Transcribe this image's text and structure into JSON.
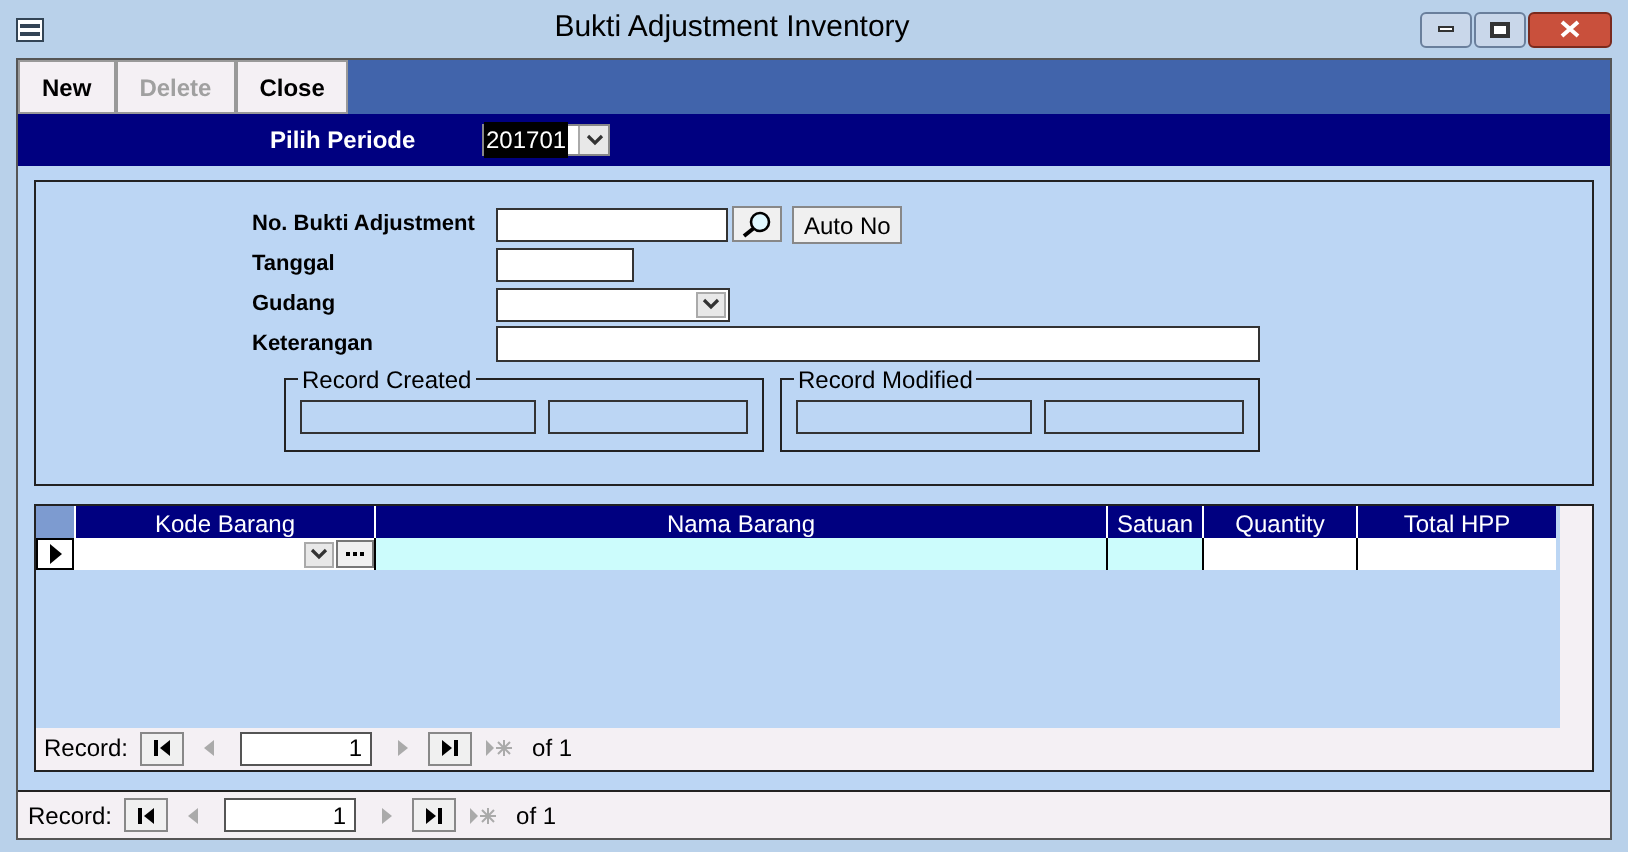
{
  "window": {
    "title": "Bukti Adjustment Inventory"
  },
  "toolbar": [
    {
      "label": "New",
      "disabled": false
    },
    {
      "label": "Delete",
      "disabled": true
    },
    {
      "label": "Close",
      "disabled": false
    }
  ],
  "period": {
    "label": "Pilih Periode",
    "value": "201701"
  },
  "fields": [
    {
      "kind": "search",
      "label": "No. Bukti Adjustment",
      "button": "Auto No"
    },
    {
      "kind": "short",
      "label": "Tanggal"
    },
    {
      "kind": "combo",
      "label": "Gudang"
    },
    {
      "kind": "wide",
      "label": "Keterangan"
    }
  ],
  "groups": [
    {
      "title": "Record Created"
    },
    {
      "title": "Record Modified"
    }
  ],
  "table": {
    "columns": [
      {
        "label": "Kode Barang"
      },
      {
        "label": "Nama Barang"
      },
      {
        "label": "Satuan"
      },
      {
        "label": "Quantity"
      },
      {
        "label": "Total HPP"
      }
    ]
  },
  "subform_nav": {
    "label": "Record:",
    "current": "1",
    "total": "of 1",
    "buttons": [
      {
        "kind": "first",
        "disabled": false
      },
      {
        "kind": "prev",
        "disabled": true
      },
      {
        "kind": "next",
        "disabled": true
      },
      {
        "kind": "last",
        "disabled": false
      },
      {
        "kind": "new",
        "disabled": true
      }
    ]
  },
  "form_nav": {
    "label": "Record:",
    "current": "1",
    "total": "of 1",
    "buttons": [
      {
        "kind": "first",
        "disabled": false
      },
      {
        "kind": "prev",
        "disabled": true
      },
      {
        "kind": "next",
        "disabled": true
      },
      {
        "kind": "last",
        "disabled": false
      },
      {
        "kind": "new",
        "disabled": true
      }
    ]
  }
}
